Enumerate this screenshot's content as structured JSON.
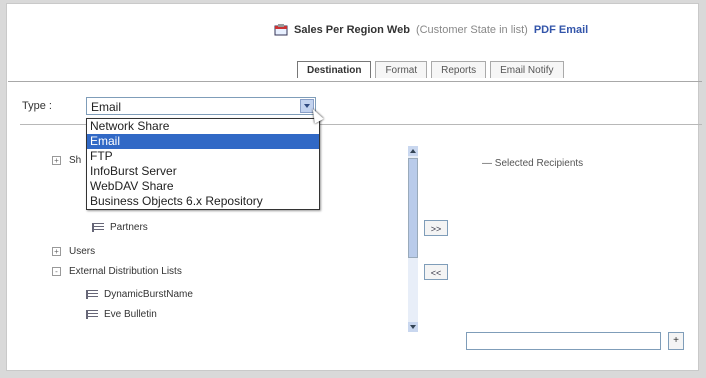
{
  "header": {
    "title": "Sales Per Region Web",
    "subtitle": "(Customer State in list)",
    "format": "PDF Email"
  },
  "tabs": [
    {
      "label": "Destination",
      "active": true
    },
    {
      "label": "Format",
      "active": false
    },
    {
      "label": "Reports",
      "active": false
    },
    {
      "label": "Email Notify",
      "active": false
    }
  ],
  "type": {
    "label": "Type :",
    "value": "Email",
    "options": [
      "Network Share",
      "Email",
      "FTP",
      "InfoBurst Server",
      "WebDAV Share",
      "Business Objects 6.x Repository"
    ],
    "selected_option": "Email"
  },
  "tree": {
    "root_partial": "Sh",
    "partners": "Partners",
    "users": "Users",
    "external_lists": "External Distribution Lists",
    "list_items": [
      "DynamicBurstName",
      "Eve Bulletin"
    ]
  },
  "buttons": {
    "add_all": ">>",
    "remove": "<<",
    "add_recipient": "+"
  },
  "recipients": {
    "label": "Selected Recipients",
    "input_value": ""
  }
}
